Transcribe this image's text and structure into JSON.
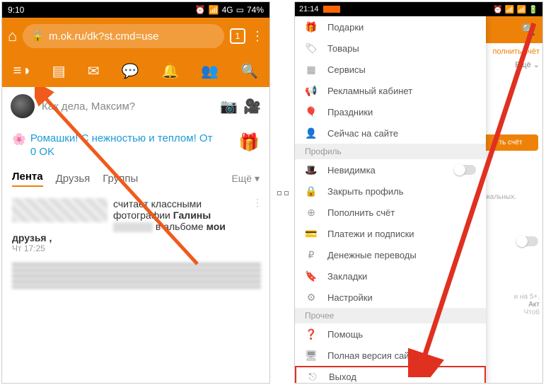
{
  "left": {
    "status": {
      "time": "9:10",
      "net": "4G",
      "battery": "74%"
    },
    "url": "m.ok.ru/dk?st.cmd=use",
    "tab_count": "1",
    "status_placeholder": "Как дела, Максим?",
    "promo_text": "Ромашки! С нежностью и теплом! От",
    "promo_price": "0 OK",
    "tabs": {
      "feed": "Лента",
      "friends": "Друзья",
      "groups": "Группы",
      "more": "Ещё ▾"
    },
    "feed": {
      "line1": "считает классными",
      "line2_a": "фотографии ",
      "line2_b": "Галины",
      "line3_a": "в альбоме ",
      "line3_b": "мои друзья ,",
      "time": "Чт 17:25"
    }
  },
  "right": {
    "status_time": "21:14",
    "under": {
      "topup": "полнить счёт",
      "more": "Ещё",
      "btn": "ть счёт",
      "note": "ыкальных.",
      "act": "Акт",
      "chtob": "Чтоб",
      "fiveplus": "и на 5+."
    },
    "sections": {
      "profile": "Профиль",
      "other": "Прочее"
    },
    "items": {
      "gifts": "Подарки",
      "goods": "Товары",
      "services": "Сервисы",
      "ads": "Рекламный кабинет",
      "holidays": "Праздники",
      "online": "Сейчас на сайте",
      "invisible": "Невидимка",
      "close_profile": "Закрыть профиль",
      "topup": "Пополнить счёт",
      "payments": "Платежи и подписки",
      "transfers": "Денежные переводы",
      "bookmarks": "Закладки",
      "settings": "Настройки",
      "help": "Помощь",
      "desktop": "Полная версия сайта",
      "exit": "Выход"
    }
  }
}
